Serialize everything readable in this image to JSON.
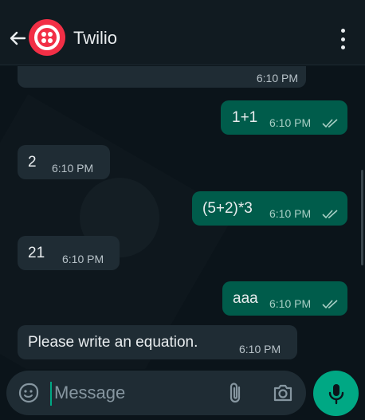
{
  "header": {
    "title": "Twilio"
  },
  "messages": [
    {
      "direction": "in",
      "text": "",
      "time": "6:10 PM"
    },
    {
      "direction": "out",
      "text": "1+1",
      "time": "6:10 PM"
    },
    {
      "direction": "in",
      "text": "2",
      "time": "6:10 PM"
    },
    {
      "direction": "out",
      "text": "(5+2)*3",
      "time": "6:10 PM"
    },
    {
      "direction": "in",
      "text": "21",
      "time": "6:10 PM"
    },
    {
      "direction": "out",
      "text": "aaa",
      "time": "6:10 PM"
    },
    {
      "direction": "in",
      "text": "Please write an equation.",
      "time": "6:10 PM"
    }
  ],
  "composer": {
    "placeholder": "Message"
  },
  "icons": {
    "back": "arrow-left-icon",
    "menu": "more-vertical-icon",
    "emoji": "sticker-icon",
    "attach": "paperclip-icon",
    "camera": "camera-icon",
    "mic": "microphone-icon",
    "read": "double-check-icon"
  },
  "colors": {
    "header_bg": "#111b21",
    "chat_bg": "#0b141a",
    "incoming_bubble": "#1f2c34",
    "outgoing_bubble": "#005c4b",
    "accent": "#00a884",
    "avatar": "#f22f46"
  }
}
